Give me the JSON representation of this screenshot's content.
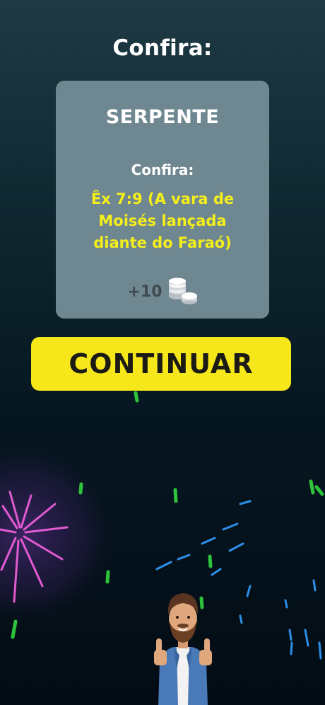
{
  "heading": "Confira:",
  "card": {
    "answer": "SERPENTE",
    "subheading": "Confira:",
    "reference": "Êx 7:9 (A vara de Moisés lançada diante do Faraó)",
    "reward": "+10",
    "reward_icon": "coins-icon"
  },
  "continue_button": "CONTINUAR",
  "colors": {
    "accent_yellow": "#f6e71b",
    "reference_text": "#f5ef1a",
    "card_bg": "#6f8790"
  }
}
